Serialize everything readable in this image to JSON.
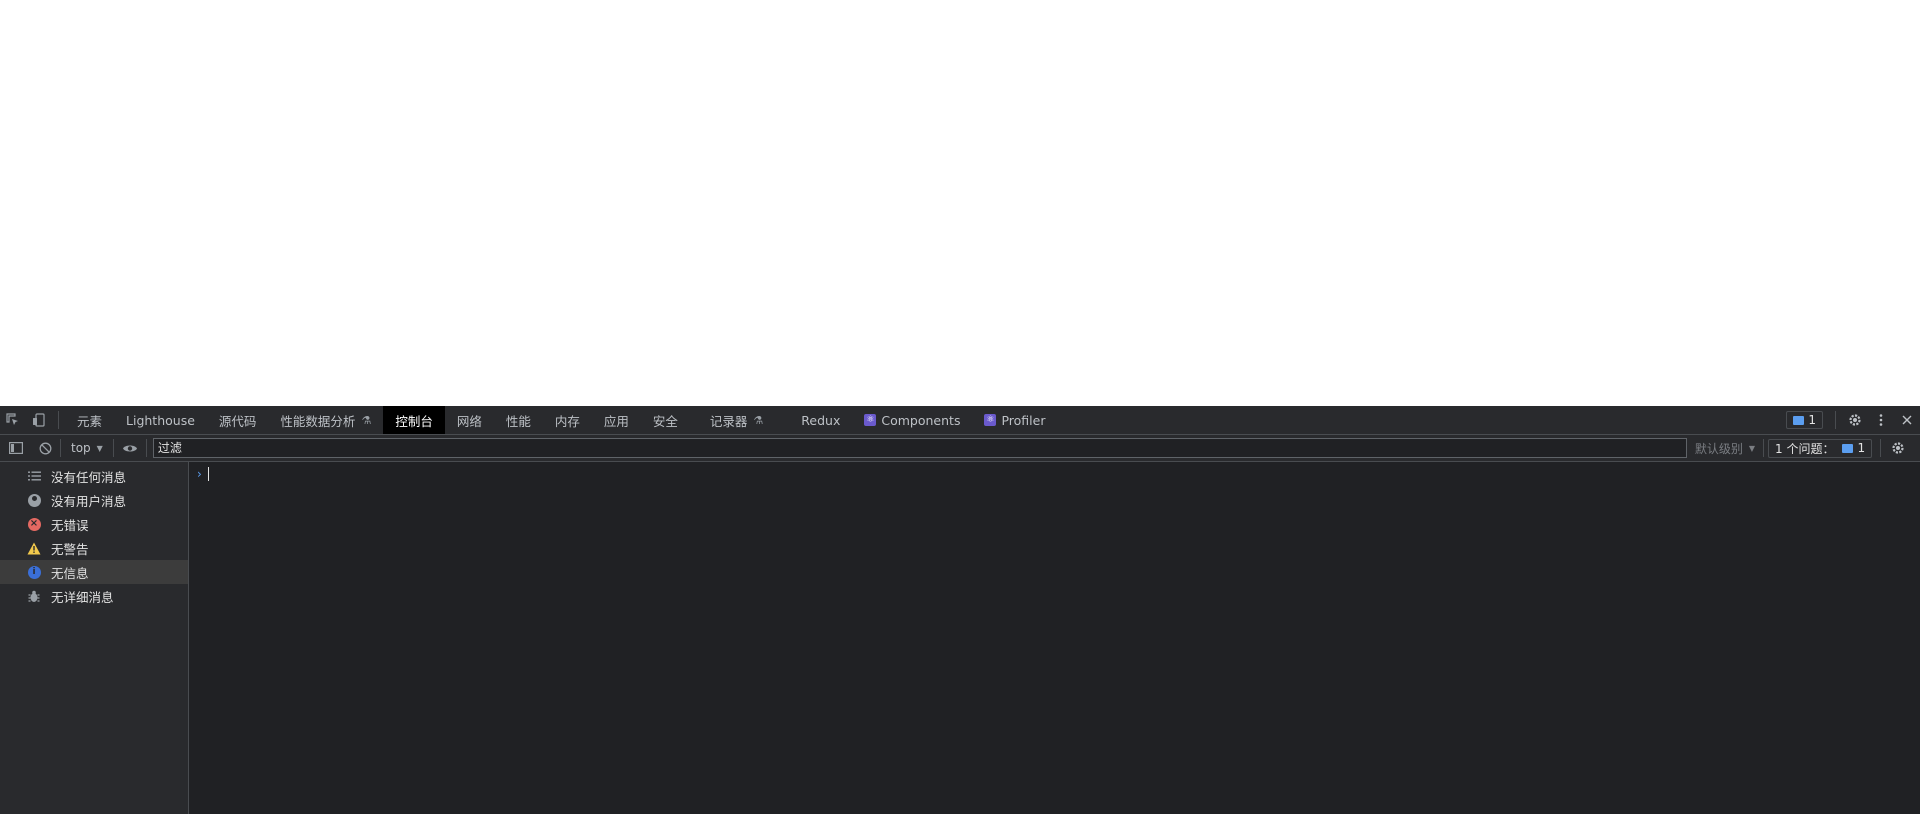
{
  "devtools": {
    "tabs": [
      {
        "label": "元素",
        "active": false
      },
      {
        "label": "Lighthouse",
        "active": false
      },
      {
        "label": "源代码",
        "active": false
      },
      {
        "label": "性能数据分析",
        "active": false,
        "experimental": true
      },
      {
        "label": "控制台",
        "active": true
      },
      {
        "label": "网络",
        "active": false
      },
      {
        "label": "性能",
        "active": false
      },
      {
        "label": "内存",
        "active": false
      },
      {
        "label": "应用",
        "active": false
      },
      {
        "label": "安全",
        "active": false
      },
      {
        "label": "记录器",
        "active": false,
        "experimental": true
      },
      {
        "label": "Redux",
        "active": false
      },
      {
        "label": "Components",
        "active": false,
        "react": true
      },
      {
        "label": "Profiler",
        "active": false,
        "react": true
      }
    ],
    "issue_count": "1"
  },
  "toolbar": {
    "context": "top",
    "filter_placeholder": "过滤",
    "levels_label": "默认级别",
    "issues_label": "1 个问题：",
    "issues_count": "1"
  },
  "sidebar": {
    "items": [
      {
        "label": "没有任何消息",
        "icon": "list-icon"
      },
      {
        "label": "没有用户消息",
        "icon": "user-icon"
      },
      {
        "label": "无错误",
        "icon": "error-icon"
      },
      {
        "label": "无警告",
        "icon": "warning-icon"
      },
      {
        "label": "无信息",
        "icon": "info-icon",
        "selected": true
      },
      {
        "label": "无详细消息",
        "icon": "bug-icon"
      }
    ]
  },
  "colors": {
    "panel_bg": "#202124",
    "toolbar_bg": "#292a2d",
    "active_tab_bg": "#000000",
    "accent_blue": "#5b9ef0",
    "error_red": "#e46962",
    "warning_yellow": "#f2c94c"
  }
}
